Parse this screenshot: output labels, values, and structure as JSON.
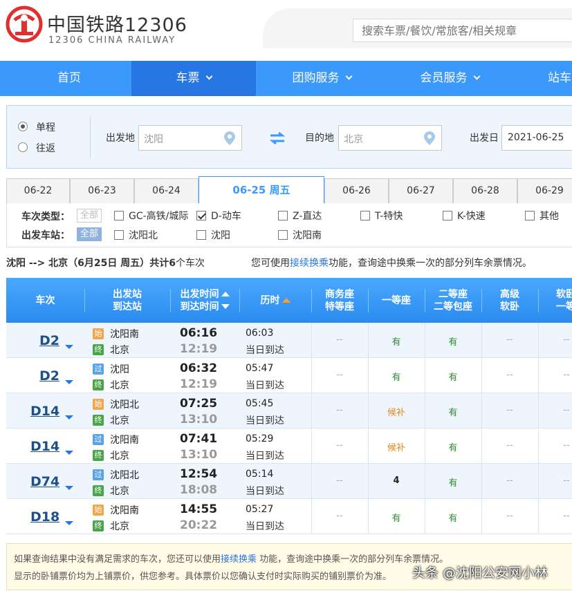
{
  "brand": {
    "cn": "中国铁路12306",
    "en": "12306 CHINA RAILWAY",
    "color": "#e12e2e"
  },
  "search": {
    "placeholder": "搜索车票/餐饮/常旅客/相关规章"
  },
  "nav": [
    {
      "label": "首页",
      "caret": false,
      "active": false
    },
    {
      "label": "车票",
      "caret": true,
      "active": true
    },
    {
      "label": "团购服务",
      "caret": true,
      "active": false
    },
    {
      "label": "会员服务",
      "caret": true,
      "active": false
    },
    {
      "label": "站车",
      "caret": false,
      "active": false
    }
  ],
  "query": {
    "one_way": "单程",
    "round_trip": "往返",
    "from_label": "出发地",
    "from_value": "沈阳",
    "to_label": "目的地",
    "to_value": "北京",
    "date_label": "出发日",
    "date_value": "2021-06-25"
  },
  "date_tabs": [
    "06-22",
    "06-23",
    "06-24",
    "06-25 周五",
    "06-26",
    "06-27",
    "06-28",
    "06-29"
  ],
  "active_tab_index": 3,
  "filters": {
    "type_label": "车次类型：",
    "station_label": "出发车站：",
    "all": "全部",
    "types": [
      {
        "label": "GC-高铁/城际",
        "checked": false
      },
      {
        "label": "D-动车",
        "checked": true
      },
      {
        "label": "Z-直达",
        "checked": false
      },
      {
        "label": "T-特快",
        "checked": false
      },
      {
        "label": "K-快速",
        "checked": false
      },
      {
        "label": "其他",
        "checked": false
      }
    ],
    "stations": [
      {
        "label": "沈阳北",
        "checked": false
      },
      {
        "label": "沈阳",
        "checked": false
      },
      {
        "label": "沈阳南",
        "checked": false
      }
    ]
  },
  "summary": {
    "route": "沈阳 --> 北京（6月25日  周五）共计",
    "count": "6",
    "suffix": "个车次",
    "hint_pre": "您可使用",
    "hint_link": "接续换乘",
    "hint_post": "功能，查询途中换乘一次的部分列车余票情况。"
  },
  "table_header": {
    "train": "车次",
    "station_1": "出发站",
    "station_2": "到达站",
    "time_1": "出发时间",
    "time_2": "到达时间",
    "duration": "历时",
    "business_1": "商务座",
    "business_2": "特等座",
    "first": "一等座",
    "second_1": "二等座",
    "second_2": "二等包座",
    "soft_1": "高级",
    "soft_2": "软卧",
    "last_1": "软卧",
    "last_2": "一等"
  },
  "train_rows": [
    {
      "no": "D2",
      "from_tag": "始",
      "from": "沈阳南",
      "to_tag": "终",
      "to": "北京",
      "dep": "06:16",
      "arr": "12:19",
      "dur": "06:03",
      "same": "当日到达",
      "business": "--",
      "first": "有",
      "second": "有",
      "soft": "--",
      "last": "--"
    },
    {
      "no": "D2",
      "from_tag": "过",
      "from": "沈阳",
      "to_tag": "终",
      "to": "北京",
      "dep": "06:32",
      "arr": "12:19",
      "dur": "05:47",
      "same": "当日到达",
      "business": "--",
      "first": "有",
      "second": "有",
      "soft": "--",
      "last": "--"
    },
    {
      "no": "D14",
      "from_tag": "始",
      "from": "沈阳北",
      "to_tag": "终",
      "to": "北京",
      "dep": "07:25",
      "arr": "13:10",
      "dur": "05:45",
      "same": "当日到达",
      "business": "--",
      "first": "候补",
      "second": "有",
      "soft": "--",
      "last": "--"
    },
    {
      "no": "D14",
      "from_tag": "过",
      "from": "沈阳南",
      "to_tag": "终",
      "to": "北京",
      "dep": "07:41",
      "arr": "13:10",
      "dur": "05:29",
      "same": "当日到达",
      "business": "--",
      "first": "候补",
      "second": "有",
      "soft": "--",
      "last": "--"
    },
    {
      "no": "D74",
      "from_tag": "过",
      "from": "沈阳北",
      "to_tag": "终",
      "to": "北京",
      "dep": "12:54",
      "arr": "18:08",
      "dur": "05:14",
      "same": "当日到达",
      "business": "--",
      "first": "4",
      "second": "有",
      "soft": "--",
      "last": "--"
    },
    {
      "no": "D18",
      "from_tag": "始",
      "from": "沈阳南",
      "to_tag": "终",
      "to": "北京",
      "dep": "14:55",
      "arr": "20:22",
      "dur": "05:27",
      "same": "当日到达",
      "business": "--",
      "first": "有",
      "second": "有",
      "soft": "--",
      "last": "--"
    }
  ],
  "notice": {
    "line1_pre": "如果查询结果中没有满足需求的车次，您还可以使用",
    "line1_link": "接续换乘",
    "line1_post": " 功能，查询途中换乘一次的部分列车余票情况。",
    "line2": "显示的卧铺票价均为上铺票价，供您参考。具体票价以您确认支付时实际购买的铺别票价为准。"
  },
  "watermark": "头条 @沈阳公安网小林"
}
